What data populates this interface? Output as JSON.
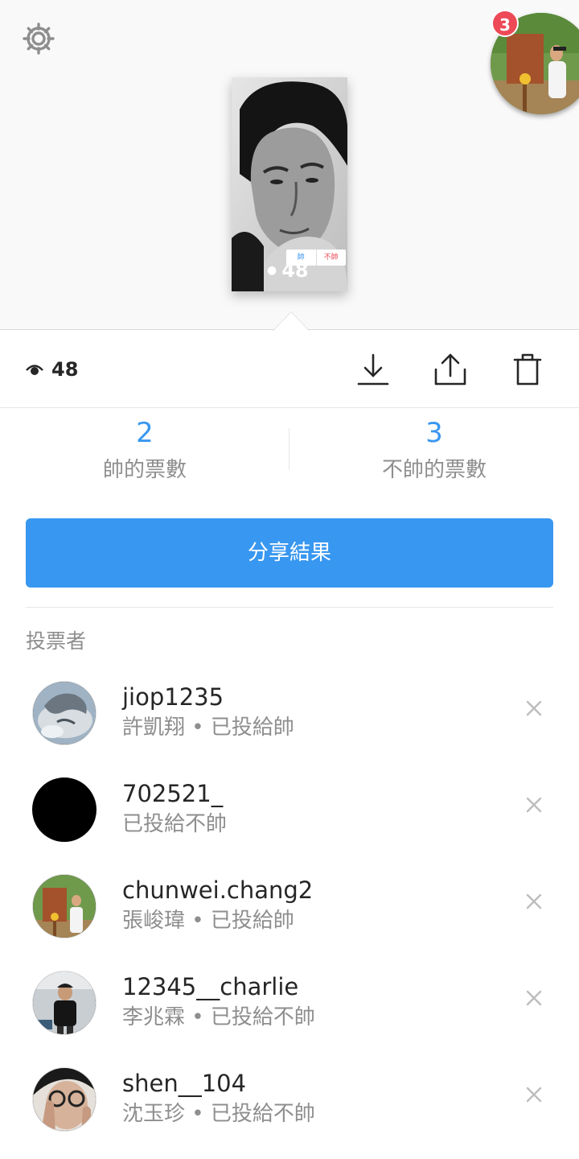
{
  "header": {
    "notification_count": "3",
    "settings_icon": "gear-icon"
  },
  "story": {
    "thumbnail_views": "48",
    "poll_yes": "帥",
    "poll_no": "不帥"
  },
  "actions": {
    "views_count": "48",
    "icons": [
      "download-icon",
      "share-icon",
      "trash-icon"
    ]
  },
  "counts": {
    "yes_count": "2",
    "yes_label": "帥的票數",
    "no_count": "3",
    "no_label": "不帥的票數"
  },
  "share_button": "分享結果",
  "voters_heading": "投票者",
  "voters": [
    {
      "username": "jiop1235",
      "detail": "許凱翔 • 已投給帥"
    },
    {
      "username": "702521_",
      "detail": "已投給不帥"
    },
    {
      "username": "chunwei.chang2",
      "detail": "張峻瑋 • 已投給帥"
    },
    {
      "username": "12345__charlie",
      "detail": "李兆霖 • 已投給不帥"
    },
    {
      "username": "shen__104",
      "detail": "沈玉珍 • 已投給不帥"
    }
  ],
  "colors": {
    "accent": "#3897f0",
    "badge": "#ed4956",
    "secondary_text": "#8e8e8e"
  }
}
